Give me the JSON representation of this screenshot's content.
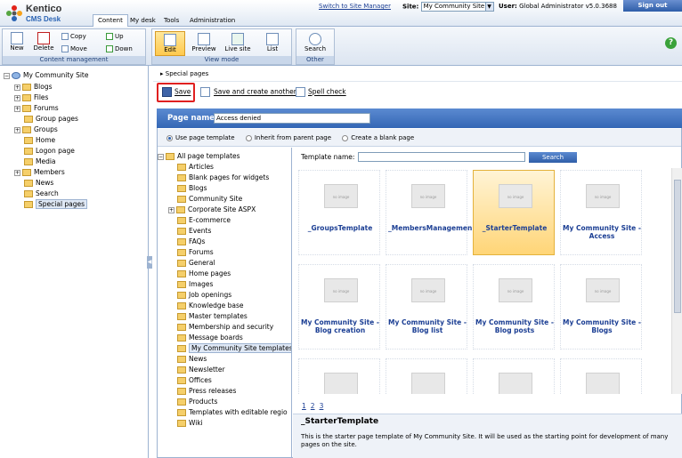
{
  "header": {
    "logo_top": "Kentico",
    "logo_bottom": "CMS Desk",
    "tabs": [
      "Content",
      "My desk",
      "Tools",
      "Administration"
    ],
    "switch_link": "Switch to Site Manager",
    "site_label": "Site:",
    "site_value": "My Community Site",
    "user_label": "User:",
    "user_value": "Global Administrator",
    "version": "v5.0.3688",
    "signout": "Sign out"
  },
  "toolbar": {
    "content_management": {
      "caption": "Content management",
      "new": "New",
      "delete": "Delete",
      "copy": "Copy",
      "move": "Move",
      "up": "Up",
      "down": "Down"
    },
    "view_mode": {
      "caption": "View mode",
      "edit": "Edit",
      "preview": "Preview",
      "live_site": "Live site",
      "list": "List"
    },
    "other": {
      "caption": "Other",
      "search": "Search"
    }
  },
  "tree": {
    "root": "My Community Site",
    "items": [
      "Blogs",
      "Files",
      "Forums",
      "Group pages",
      "Groups",
      "Home",
      "Logon page",
      "Media",
      "Members",
      "News",
      "Search",
      "Special pages"
    ]
  },
  "breadcrumb": "Special pages",
  "actions": {
    "save": "Save",
    "save_create": "Save and create another",
    "spell": "Spell check"
  },
  "page_name": {
    "label": "Page name:",
    "value": "Access denied"
  },
  "template_options": [
    "Use page template",
    "Inherit from parent page",
    "Create a blank page"
  ],
  "categories": {
    "root": "All page templates",
    "items": [
      "Articles",
      "Blank pages for widgets",
      "Blogs",
      "Community Site",
      "Corporate Site ASPX",
      "E-commerce",
      "Events",
      "FAQs",
      "Forums",
      "General",
      "Home pages",
      "Images",
      "Job openings",
      "Knowledge base",
      "Master templates",
      "Membership and security",
      "Message boards",
      "My Community Site templates",
      "News",
      "Newsletter",
      "Offices",
      "Press releases",
      "Products",
      "Templates with editable regio",
      "Wiki"
    ]
  },
  "template_search": {
    "label": "Template name:",
    "button": "Search"
  },
  "templates": [
    {
      "name": "_GroupsTemplate",
      "thumb": "no image"
    },
    {
      "name": "_MembersManagemen",
      "thumb": "no image"
    },
    {
      "name": "_StarterTemplate",
      "thumb": "no image"
    },
    {
      "name": "My Community Site - Access",
      "thumb": "no image"
    },
    {
      "name": "My Community Site - Blog creation",
      "thumb": "no image"
    },
    {
      "name": "My Community Site - Blog list",
      "thumb": "no image"
    },
    {
      "name": "My Community Site - Blog posts",
      "thumb": "no image"
    },
    {
      "name": "My Community Site - Blogs",
      "thumb": "no image"
    },
    {
      "name": "",
      "thumb": ""
    },
    {
      "name": "",
      "thumb": ""
    },
    {
      "name": "",
      "thumb": ""
    },
    {
      "name": "",
      "thumb": ""
    }
  ],
  "pager": [
    "1",
    "2",
    "3"
  ],
  "description": {
    "title": "_StarterTemplate",
    "text": "This is the starter page template of My Community Site. It will be used as the starting point for development of many pages on the site."
  }
}
